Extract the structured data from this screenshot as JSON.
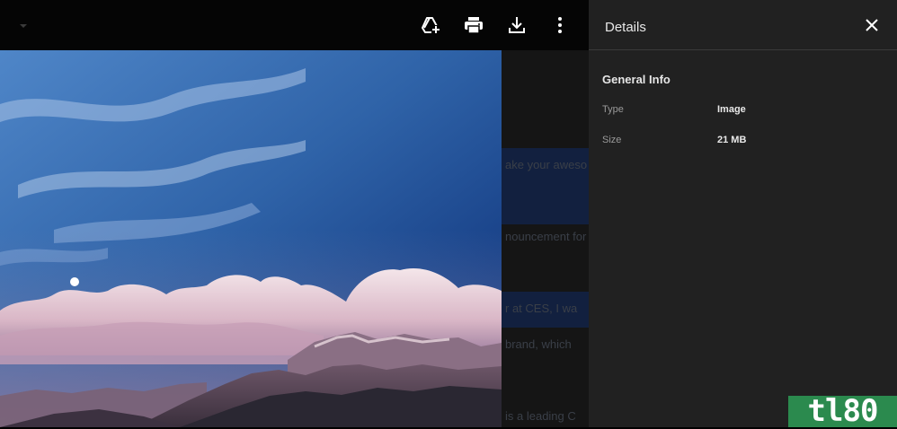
{
  "toolbar": {
    "add_to_drive_icon": "add-to-drive-icon",
    "print_icon": "print-icon",
    "download_icon": "download-icon",
    "more_icon": "more-vert-icon"
  },
  "background_text": {
    "line1": "ake your aweso",
    "line2": "nouncement for",
    "line3": "r at CES, I wa",
    "line4": "brand,  which",
    "line5": "is a leading C"
  },
  "details_panel": {
    "title": "Details",
    "section_title": "General Info",
    "rows": [
      {
        "label": "Type",
        "value": "Image"
      },
      {
        "label": "Size",
        "value": "21 MB"
      }
    ]
  },
  "watermark": {
    "text": "tl80"
  },
  "colors": {
    "panel_bg": "#212121",
    "topbar_bg": "#050505",
    "logo_green": "#2b8a4e"
  }
}
